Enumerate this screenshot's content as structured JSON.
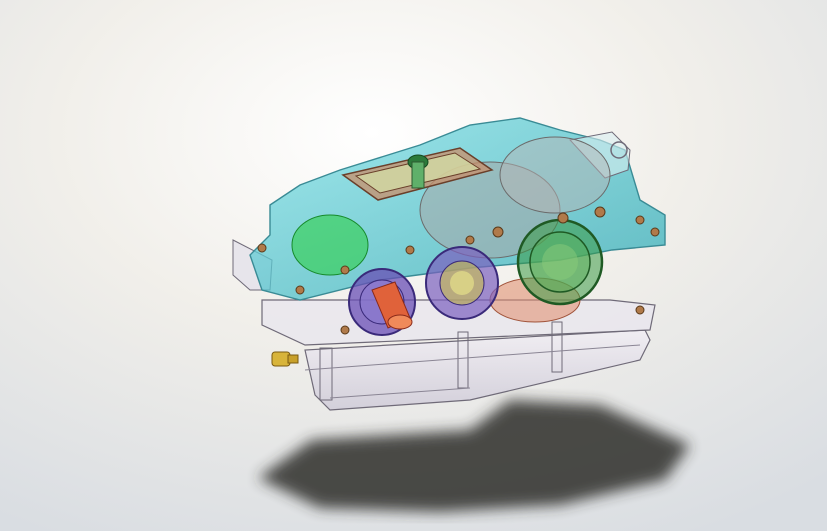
{
  "scene": {
    "subject": "gearbox-3d-model",
    "colors": {
      "bg_top": "#d9dde2",
      "bg_bottom": "#ebe8df",
      "housing_cover": "#3fc4cf",
      "housing_base": "#e3e1ea",
      "housing_outline": "#6f6a78",
      "inspection_cover": "#c98f6a",
      "gear_gray": "#a8a8a8",
      "bearing_purple": "#6a4fb5",
      "bearing_green": "#3a9a45",
      "shaft_orange": "#e0623a",
      "plug_yellow": "#d8b43a",
      "shadow": "#2e2e2c"
    }
  }
}
